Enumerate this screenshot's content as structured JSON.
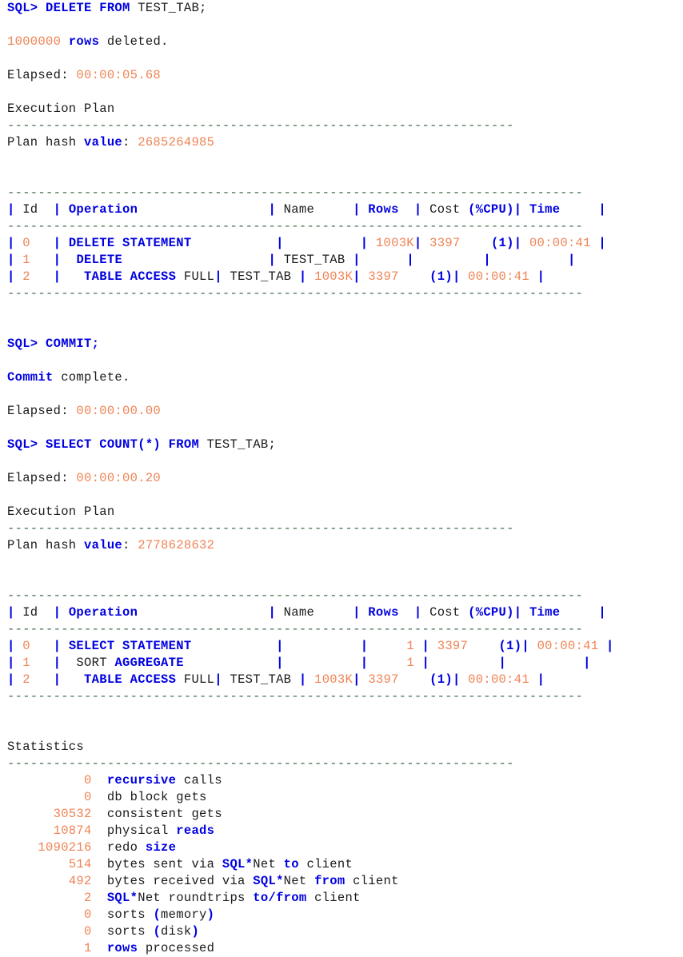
{
  "terminal": {
    "app": "SQL*Plus",
    "background": "#ffffff",
    "colors": {
      "keyword": "#0000e0",
      "number": "#ef8354",
      "plain": "#1a1a1a",
      "separator": "#3d6b47",
      "pipe": "#0000e0"
    },
    "prompt": "SQL>"
  },
  "statements": [
    {
      "prompt": "SQL>",
      "sql": "DELETE FROM TEST_TAB;",
      "result": "1000000 rows deleted.",
      "result_count": "1000000",
      "result_text_kw": "rows",
      "result_text_tail": " deleted.",
      "elapsed_label": "Elapsed:",
      "elapsed": "00:00:05.68",
      "plan_title": "Execution Plan",
      "plan_hash_label_a": "Plan hash ",
      "plan_hash_label_b": "value",
      "plan_hash_value": "2685264985"
    },
    {
      "prompt": "SQL>",
      "sql": "COMMIT;",
      "result_kw": "Commit",
      "result_tail": " complete.",
      "elapsed_label": "Elapsed:",
      "elapsed": "00:00:00.00"
    },
    {
      "prompt": "SQL>",
      "sql": "SELECT COUNT(*) FROM TEST_TAB;",
      "elapsed_label": "Elapsed:",
      "elapsed": "00:00:00.20",
      "plan_title": "Execution Plan",
      "plan_hash_label_a": "Plan hash ",
      "plan_hash_label_b": "value",
      "plan_hash_value": "2778628632"
    }
  ],
  "plan_table_headers": [
    "Id",
    "Operation",
    "Name",
    "Rows",
    "Cost (%CPU)",
    "Time"
  ],
  "plan_one": {
    "rule_full": "----------------------------------------------------------------------------",
    "rows": [
      {
        "id": "0",
        "operation": "DELETE STATEMENT",
        "name": "",
        "rows": "1003K",
        "cost": "3397",
        "cpu": "(1)",
        "time": "00:00:41"
      },
      {
        "id": "1",
        "operation": "DELETE",
        "name": "TEST_TAB",
        "rows": "",
        "cost": "",
        "cpu": "",
        "time": ""
      },
      {
        "id": "2",
        "operation": "TABLE ACCESS FULL",
        "name": "TEST_TAB",
        "rows": "1003K",
        "cost": "3397",
        "cpu": "(1)",
        "time": "00:00:41"
      }
    ]
  },
  "plan_two": {
    "rows": [
      {
        "id": "0",
        "operation": "SELECT STATEMENT",
        "name": "",
        "rows": "1",
        "cost": "3397",
        "cpu": "(1)",
        "time": "00:00:41"
      },
      {
        "id": "1",
        "operation": "SORT AGGREGATE",
        "name": "",
        "rows": "1",
        "cost": "",
        "cpu": "",
        "time": ""
      },
      {
        "id": "2",
        "operation": "TABLE ACCESS FULL",
        "name": "TEST_TAB",
        "rows": "1003K",
        "cost": "3397",
        "cpu": "(1)",
        "time": "00:00:41"
      }
    ]
  },
  "statistics": {
    "title": "Statistics",
    "rule": "----------------------------------------------------------------",
    "items": [
      {
        "value": "0",
        "label": "recursive calls"
      },
      {
        "value": "0",
        "label": "db block gets"
      },
      {
        "value": "30532",
        "label": "consistent gets"
      },
      {
        "value": "10874",
        "label": "physical reads"
      },
      {
        "value": "1090216",
        "label": "redo size"
      },
      {
        "value": "514",
        "label": "bytes sent via SQL*Net to client"
      },
      {
        "value": "492",
        "label": "bytes received via SQL*Net from client"
      },
      {
        "value": "2",
        "label": "SQL*Net roundtrips to/from client"
      },
      {
        "value": "0",
        "label": "sorts (memory)"
      },
      {
        "value": "0",
        "label": "sorts (disk)"
      },
      {
        "value": "1",
        "label": "rows processed"
      }
    ]
  },
  "rules": {
    "plan_underline": "------------------------------------------------------------------",
    "table_rule": "---------------------------------------------------------------------------",
    "stats_underline": "------------------------------------------------------------------"
  }
}
